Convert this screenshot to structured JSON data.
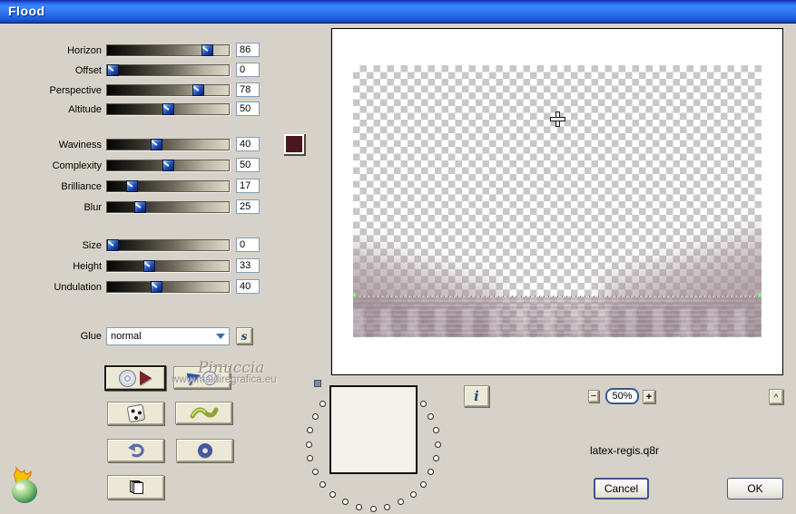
{
  "window": {
    "title": "Flood"
  },
  "sliders": [
    {
      "label": "Horizon",
      "value": "86"
    },
    {
      "label": "Offset",
      "value": "0"
    },
    {
      "label": "Perspective",
      "value": "78"
    },
    {
      "label": "Altitude",
      "value": "50"
    },
    {
      "label": "Waviness",
      "value": "40"
    },
    {
      "label": "Complexity",
      "value": "50"
    },
    {
      "label": "Brilliance",
      "value": "17"
    },
    {
      "label": "Blur",
      "value": "25"
    },
    {
      "label": "Size",
      "value": "0"
    },
    {
      "label": "Height",
      "value": "33"
    },
    {
      "label": "Undulation",
      "value": "40"
    }
  ],
  "color_swatch": {
    "color": "#4a1622"
  },
  "glue": {
    "label": "Glue",
    "selected": "normal"
  },
  "s_button": {
    "label": "s"
  },
  "icons": {
    "tool_buttons": [
      "cd-play-icon",
      "arrow-cd-icon",
      "dice-icon",
      "wave-icon",
      "undo-icon",
      "ring-icon",
      "pages-icon"
    ],
    "logo": "flaming-pear-icon",
    "cursor": "crosshair-icon"
  },
  "watermark": {
    "line1": "Pinuccia",
    "line2": "www.maidiregrafica.eu"
  },
  "preview": {
    "zoom_level": "50%",
    "filename": "latex-regis.q8r",
    "checker_light": "#ffffff",
    "checker_dark": "#c8c8c8",
    "flood_tint": "#a2909a"
  },
  "controls": {
    "zoom_out": "−",
    "zoom_in": "+",
    "info": "i",
    "collapse": "^"
  },
  "actions": {
    "cancel": "Cancel",
    "ok": "OK"
  },
  "memory": {
    "dot_count": 28
  }
}
